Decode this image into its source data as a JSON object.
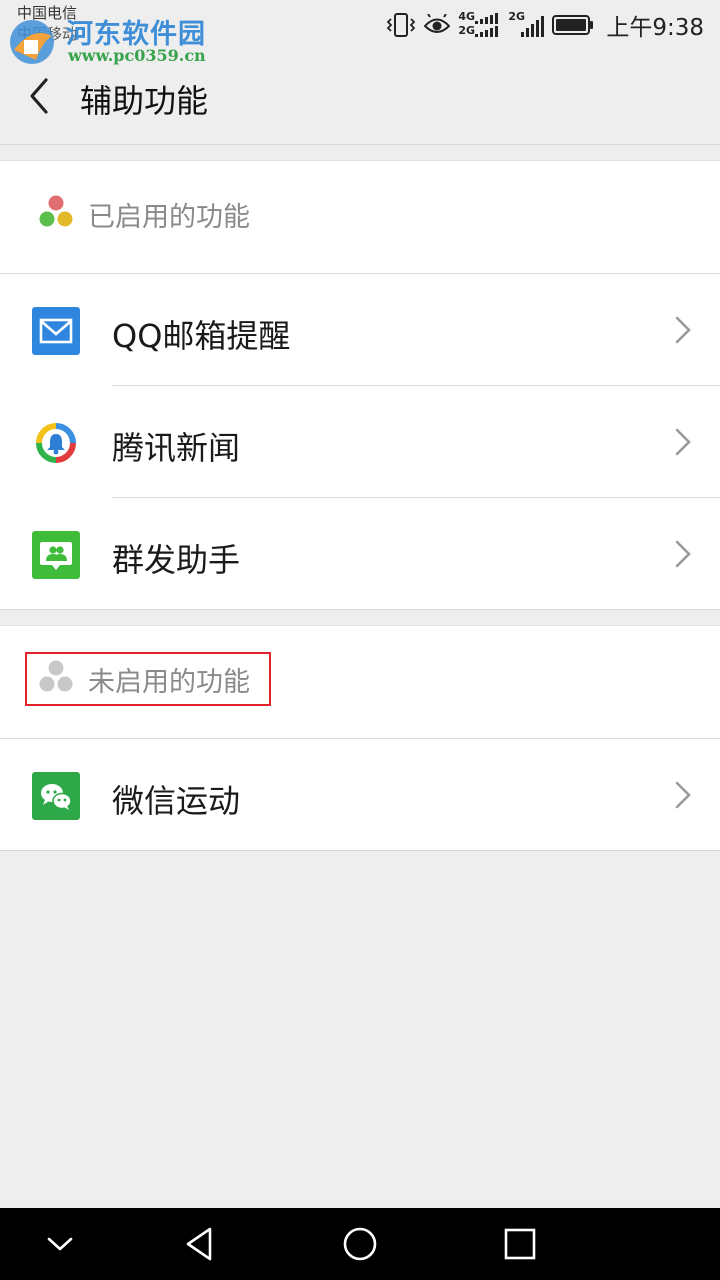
{
  "status_bar": {
    "carrier_primary": "中国电信",
    "carrier_secondary": "中国移动",
    "network_1": "4G",
    "network_1b": "2G",
    "network_2": "2G",
    "time": "上午9:38"
  },
  "watermark": {
    "title": "河东软件园",
    "url": "www.pc0359.cn"
  },
  "app_bar": {
    "title": "辅助功能"
  },
  "sections": {
    "enabled": {
      "label": "已启用的功能",
      "items": [
        {
          "label": "QQ邮箱提醒",
          "icon": "mail-icon",
          "icon_color": "#2e86de"
        },
        {
          "label": "腾讯新闻",
          "icon": "tencent-news-icon",
          "icon_color": "#ffffff"
        },
        {
          "label": "群发助手",
          "icon": "group-message-icon",
          "icon_color": "#3fbc3a"
        }
      ]
    },
    "disabled": {
      "label": "未启用的功能",
      "items": [
        {
          "label": "微信运动",
          "icon": "wechat-sport-icon",
          "icon_color": "#2fa84a"
        }
      ]
    }
  },
  "colors": {
    "background": "#eeeeee",
    "highlight_box": "#e0232a",
    "section_label": "#8a8a8a"
  }
}
